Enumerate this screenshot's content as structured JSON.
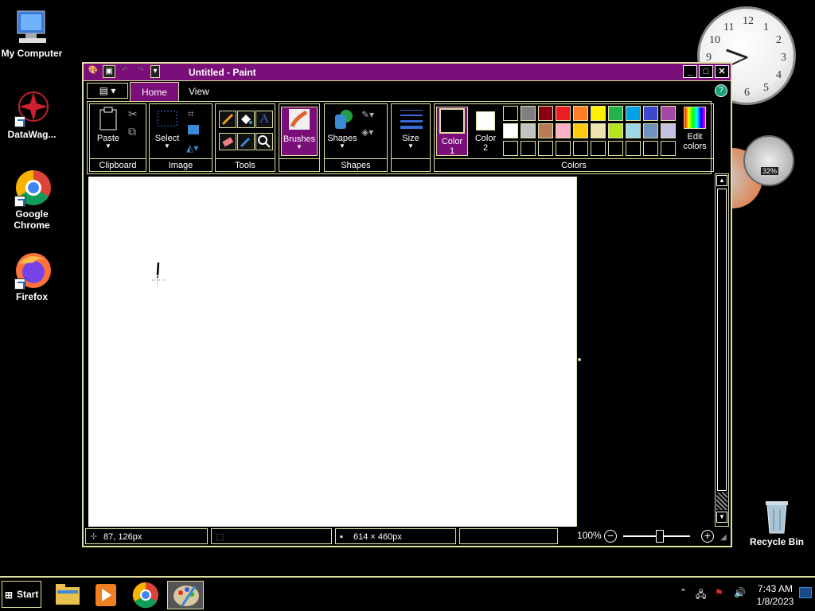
{
  "desktop": {
    "icons": [
      {
        "label": "My Computer"
      },
      {
        "label": "DataWag..."
      },
      {
        "label": "Google Chrome"
      },
      {
        "label": "Firefox"
      },
      {
        "label": "Recycle Bin"
      }
    ],
    "clock_numbers": [
      "12",
      "1",
      "2",
      "3",
      "4",
      "5",
      "6",
      "7",
      "8",
      "9",
      "10",
      "11"
    ],
    "gauge_label": "32%"
  },
  "window": {
    "title": "Untitled - Paint",
    "controls": {
      "minimize": "_",
      "maximize": "□",
      "close": "✕"
    }
  },
  "ribbon": {
    "tabs": [
      "Home",
      "View"
    ],
    "groups": {
      "clipboard": {
        "label": "Clipboard",
        "paste": "Paste"
      },
      "image": {
        "label": "Image",
        "select": "Select"
      },
      "tools": {
        "label": "Tools"
      },
      "brushes": {
        "label": "Brushes"
      },
      "shapes": {
        "label": "Shapes",
        "shapes_btn": "Shapes"
      },
      "size": {
        "label": "Size"
      },
      "colors": {
        "label": "Colors",
        "color1": "Color",
        "color1_num": "1",
        "color2": "Color",
        "color2_num": "2",
        "edit1": "Edit",
        "edit2": "colors"
      }
    },
    "palette_row1": [
      "#000000",
      "#7f7f7f",
      "#880015",
      "#ed1c24",
      "#ff7f27",
      "#fff200",
      "#22b14c",
      "#00a2e8",
      "#3f48cc",
      "#a349a4"
    ],
    "palette_row2": [
      "#ffffff",
      "#c3c3c3",
      "#b97a57",
      "#ffaec9",
      "#ffc90e",
      "#efe4b0",
      "#b5e61d",
      "#99d9ea",
      "#7092be",
      "#c8bfe7"
    ]
  },
  "status": {
    "cursor_pos": "87, 126px",
    "canvas_size": "614 × 460px",
    "zoom": "100%",
    "zoom_level": 0.55
  },
  "taskbar": {
    "start": "Start",
    "time": "7:43 AM",
    "date": "1/8/2023"
  }
}
